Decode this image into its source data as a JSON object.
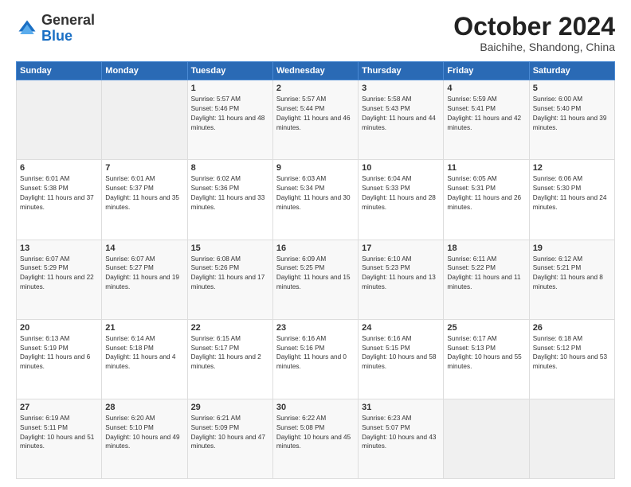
{
  "header": {
    "logo_general": "General",
    "logo_blue": "Blue",
    "month_title": "October 2024",
    "subtitle": "Baichihe, Shandong, China"
  },
  "weekdays": [
    "Sunday",
    "Monday",
    "Tuesday",
    "Wednesday",
    "Thursday",
    "Friday",
    "Saturday"
  ],
  "weeks": [
    [
      {
        "day": "",
        "sunrise": "",
        "sunset": "",
        "daylight": ""
      },
      {
        "day": "",
        "sunrise": "",
        "sunset": "",
        "daylight": ""
      },
      {
        "day": "1",
        "sunrise": "Sunrise: 5:57 AM",
        "sunset": "Sunset: 5:46 PM",
        "daylight": "Daylight: 11 hours and 48 minutes."
      },
      {
        "day": "2",
        "sunrise": "Sunrise: 5:57 AM",
        "sunset": "Sunset: 5:44 PM",
        "daylight": "Daylight: 11 hours and 46 minutes."
      },
      {
        "day": "3",
        "sunrise": "Sunrise: 5:58 AM",
        "sunset": "Sunset: 5:43 PM",
        "daylight": "Daylight: 11 hours and 44 minutes."
      },
      {
        "day": "4",
        "sunrise": "Sunrise: 5:59 AM",
        "sunset": "Sunset: 5:41 PM",
        "daylight": "Daylight: 11 hours and 42 minutes."
      },
      {
        "day": "5",
        "sunrise": "Sunrise: 6:00 AM",
        "sunset": "Sunset: 5:40 PM",
        "daylight": "Daylight: 11 hours and 39 minutes."
      }
    ],
    [
      {
        "day": "6",
        "sunrise": "Sunrise: 6:01 AM",
        "sunset": "Sunset: 5:38 PM",
        "daylight": "Daylight: 11 hours and 37 minutes."
      },
      {
        "day": "7",
        "sunrise": "Sunrise: 6:01 AM",
        "sunset": "Sunset: 5:37 PM",
        "daylight": "Daylight: 11 hours and 35 minutes."
      },
      {
        "day": "8",
        "sunrise": "Sunrise: 6:02 AM",
        "sunset": "Sunset: 5:36 PM",
        "daylight": "Daylight: 11 hours and 33 minutes."
      },
      {
        "day": "9",
        "sunrise": "Sunrise: 6:03 AM",
        "sunset": "Sunset: 5:34 PM",
        "daylight": "Daylight: 11 hours and 30 minutes."
      },
      {
        "day": "10",
        "sunrise": "Sunrise: 6:04 AM",
        "sunset": "Sunset: 5:33 PM",
        "daylight": "Daylight: 11 hours and 28 minutes."
      },
      {
        "day": "11",
        "sunrise": "Sunrise: 6:05 AM",
        "sunset": "Sunset: 5:31 PM",
        "daylight": "Daylight: 11 hours and 26 minutes."
      },
      {
        "day": "12",
        "sunrise": "Sunrise: 6:06 AM",
        "sunset": "Sunset: 5:30 PM",
        "daylight": "Daylight: 11 hours and 24 minutes."
      }
    ],
    [
      {
        "day": "13",
        "sunrise": "Sunrise: 6:07 AM",
        "sunset": "Sunset: 5:29 PM",
        "daylight": "Daylight: 11 hours and 22 minutes."
      },
      {
        "day": "14",
        "sunrise": "Sunrise: 6:07 AM",
        "sunset": "Sunset: 5:27 PM",
        "daylight": "Daylight: 11 hours and 19 minutes."
      },
      {
        "day": "15",
        "sunrise": "Sunrise: 6:08 AM",
        "sunset": "Sunset: 5:26 PM",
        "daylight": "Daylight: 11 hours and 17 minutes."
      },
      {
        "day": "16",
        "sunrise": "Sunrise: 6:09 AM",
        "sunset": "Sunset: 5:25 PM",
        "daylight": "Daylight: 11 hours and 15 minutes."
      },
      {
        "day": "17",
        "sunrise": "Sunrise: 6:10 AM",
        "sunset": "Sunset: 5:23 PM",
        "daylight": "Daylight: 11 hours and 13 minutes."
      },
      {
        "day": "18",
        "sunrise": "Sunrise: 6:11 AM",
        "sunset": "Sunset: 5:22 PM",
        "daylight": "Daylight: 11 hours and 11 minutes."
      },
      {
        "day": "19",
        "sunrise": "Sunrise: 6:12 AM",
        "sunset": "Sunset: 5:21 PM",
        "daylight": "Daylight: 11 hours and 8 minutes."
      }
    ],
    [
      {
        "day": "20",
        "sunrise": "Sunrise: 6:13 AM",
        "sunset": "Sunset: 5:19 PM",
        "daylight": "Daylight: 11 hours and 6 minutes."
      },
      {
        "day": "21",
        "sunrise": "Sunrise: 6:14 AM",
        "sunset": "Sunset: 5:18 PM",
        "daylight": "Daylight: 11 hours and 4 minutes."
      },
      {
        "day": "22",
        "sunrise": "Sunrise: 6:15 AM",
        "sunset": "Sunset: 5:17 PM",
        "daylight": "Daylight: 11 hours and 2 minutes."
      },
      {
        "day": "23",
        "sunrise": "Sunrise: 6:16 AM",
        "sunset": "Sunset: 5:16 PM",
        "daylight": "Daylight: 11 hours and 0 minutes."
      },
      {
        "day": "24",
        "sunrise": "Sunrise: 6:16 AM",
        "sunset": "Sunset: 5:15 PM",
        "daylight": "Daylight: 10 hours and 58 minutes."
      },
      {
        "day": "25",
        "sunrise": "Sunrise: 6:17 AM",
        "sunset": "Sunset: 5:13 PM",
        "daylight": "Daylight: 10 hours and 55 minutes."
      },
      {
        "day": "26",
        "sunrise": "Sunrise: 6:18 AM",
        "sunset": "Sunset: 5:12 PM",
        "daylight": "Daylight: 10 hours and 53 minutes."
      }
    ],
    [
      {
        "day": "27",
        "sunrise": "Sunrise: 6:19 AM",
        "sunset": "Sunset: 5:11 PM",
        "daylight": "Daylight: 10 hours and 51 minutes."
      },
      {
        "day": "28",
        "sunrise": "Sunrise: 6:20 AM",
        "sunset": "Sunset: 5:10 PM",
        "daylight": "Daylight: 10 hours and 49 minutes."
      },
      {
        "day": "29",
        "sunrise": "Sunrise: 6:21 AM",
        "sunset": "Sunset: 5:09 PM",
        "daylight": "Daylight: 10 hours and 47 minutes."
      },
      {
        "day": "30",
        "sunrise": "Sunrise: 6:22 AM",
        "sunset": "Sunset: 5:08 PM",
        "daylight": "Daylight: 10 hours and 45 minutes."
      },
      {
        "day": "31",
        "sunrise": "Sunrise: 6:23 AM",
        "sunset": "Sunset: 5:07 PM",
        "daylight": "Daylight: 10 hours and 43 minutes."
      },
      {
        "day": "",
        "sunrise": "",
        "sunset": "",
        "daylight": ""
      },
      {
        "day": "",
        "sunrise": "",
        "sunset": "",
        "daylight": ""
      }
    ]
  ]
}
